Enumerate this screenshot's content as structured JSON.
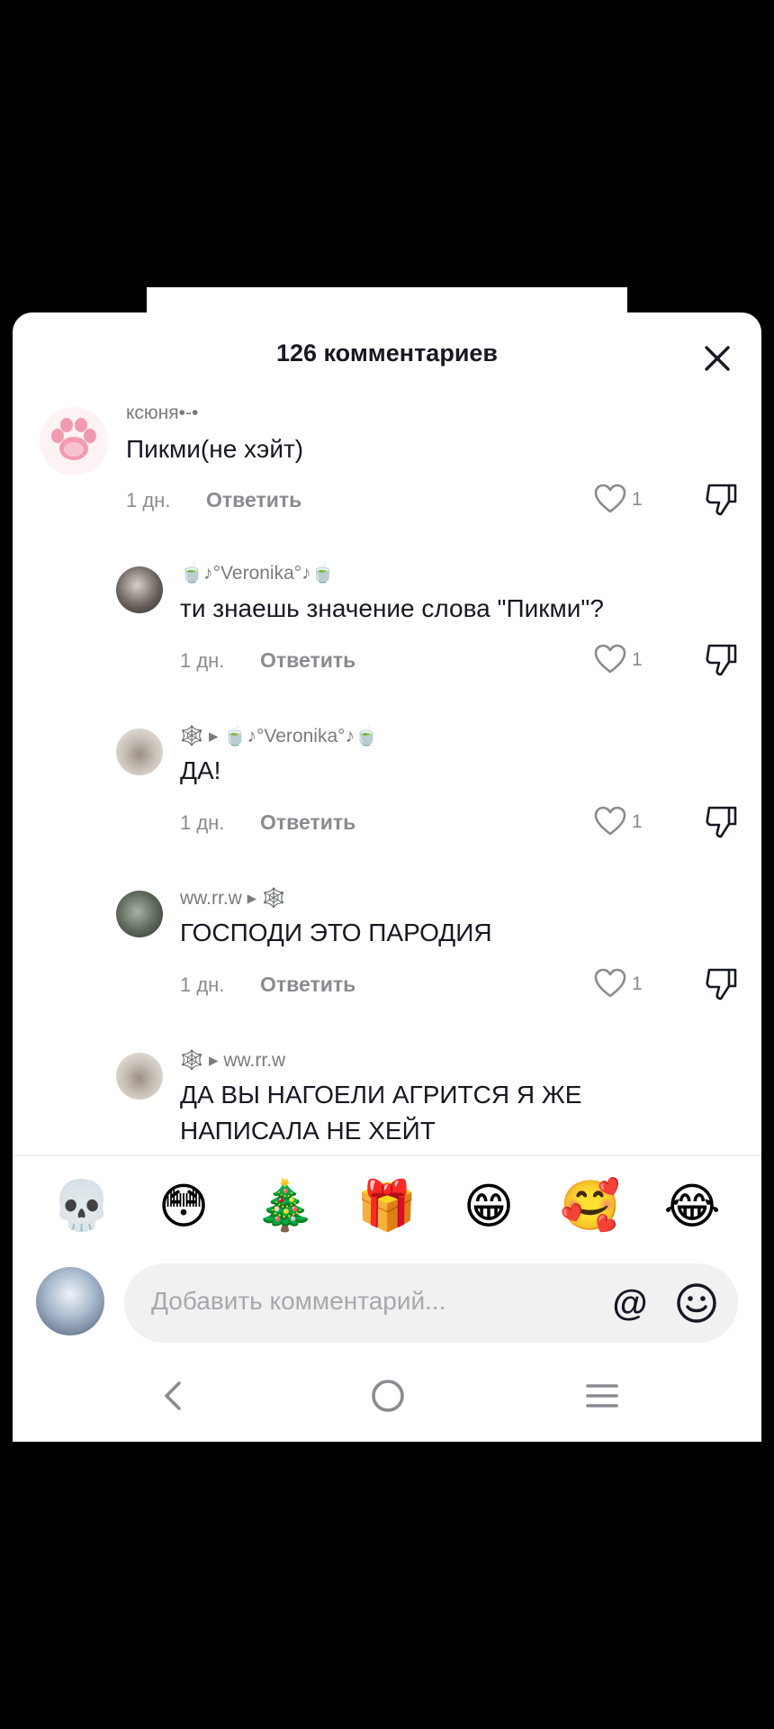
{
  "header": {
    "title": "126 комментариев"
  },
  "comments": [
    {
      "username": "ксюня•-•",
      "text": "Пикми(не хэйт)",
      "time": "1 дн.",
      "reply_label": "Ответить",
      "likes": "1"
    },
    {
      "username": "🍵♪°Veronika°♪🍵",
      "text": "ти знаешь значение слова \"Пикми\"?",
      "time": "1 дн.",
      "reply_label": "Ответить",
      "likes": "1"
    },
    {
      "username": "🕸️ ▸ 🍵♪°Veronika°♪🍵",
      "text": "ДА!",
      "time": "1 дн.",
      "reply_label": "Ответить",
      "likes": "1"
    },
    {
      "username": "ww.rr.w ▸ 🕸️",
      "text": "ГОСПОДИ ЭТО ПАРОДИЯ",
      "time": "1 дн.",
      "reply_label": "Ответить",
      "likes": "1"
    },
    {
      "username": "🕸️ ▸ ww.rr.w",
      "text_line1": "ДА ВЫ НАГОЕЛИ АГРИТСЯ Я ЖЕ",
      "text_line2": "НАПИСАЛА НЕ ХЕЙТ"
    }
  ],
  "emoji_bar": [
    "💀",
    "😳",
    "🎄",
    "🎁",
    "😁",
    "🥰",
    "😂"
  ],
  "composer": {
    "placeholder": "Добавить комментарий...",
    "at_symbol": "@"
  },
  "icons": {
    "close": "close-icon",
    "like": "heart-outline-icon",
    "dislike": "thumbs-down-icon",
    "smile": "smiley-face-icon",
    "nav": [
      "back-chevron-icon",
      "home-circle-icon",
      "menu-lines-icon"
    ]
  }
}
